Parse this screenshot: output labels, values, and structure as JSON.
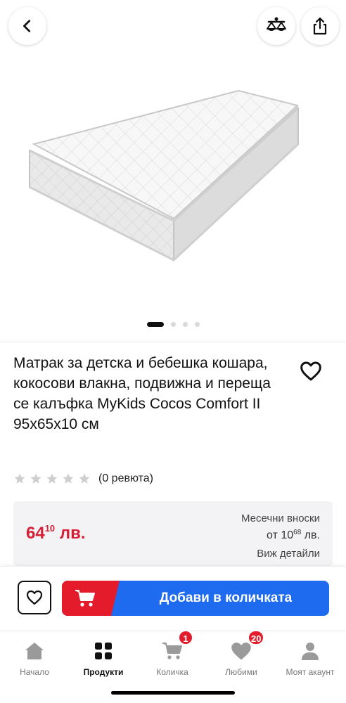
{
  "header": {
    "back_icon": "chevron-left-icon",
    "compare_icon": "scales-icon",
    "share_icon": "share-icon"
  },
  "gallery": {
    "image_alt": "Mattress",
    "total_images": 4,
    "active_index": 0
  },
  "product": {
    "title": "Матрак за детска и бебешка кошара, кокосови влакна, подвижна и переща се калъфка MyKids Cocos Comfort II 95x65x10 см",
    "favorite_icon": "heart-outline-icon"
  },
  "rating": {
    "stars_filled": 0,
    "stars_total": 5,
    "reviews_label": "(0 ревюта)"
  },
  "price": {
    "whole": "64",
    "cents": "10",
    "currency": "лв.",
    "installments_title": "Месечни вноски",
    "installments_prefix": "от",
    "installments_whole": "10",
    "installments_cents": "68",
    "installments_currency": "лв.",
    "details_link": "Виж детайли",
    "color": "#d51f34"
  },
  "cta": {
    "favorite_icon": "heart-outline-icon",
    "cart_icon": "cart-icon",
    "add_label": "Добави в количката",
    "primary_color": "#1f6bf0",
    "accent_color": "#e31b2b"
  },
  "tabbar": {
    "tabs": [
      {
        "label": "Начало",
        "icon": "home-icon",
        "active": false
      },
      {
        "label": "Продукти",
        "icon": "grid-icon",
        "active": true
      },
      {
        "label": "Количка",
        "icon": "cart-icon",
        "active": false,
        "badge": "1"
      },
      {
        "label": "Любими",
        "icon": "heart-icon",
        "active": false,
        "badge": "20"
      },
      {
        "label": "Моят акаунт",
        "icon": "user-icon",
        "active": false
      }
    ]
  }
}
